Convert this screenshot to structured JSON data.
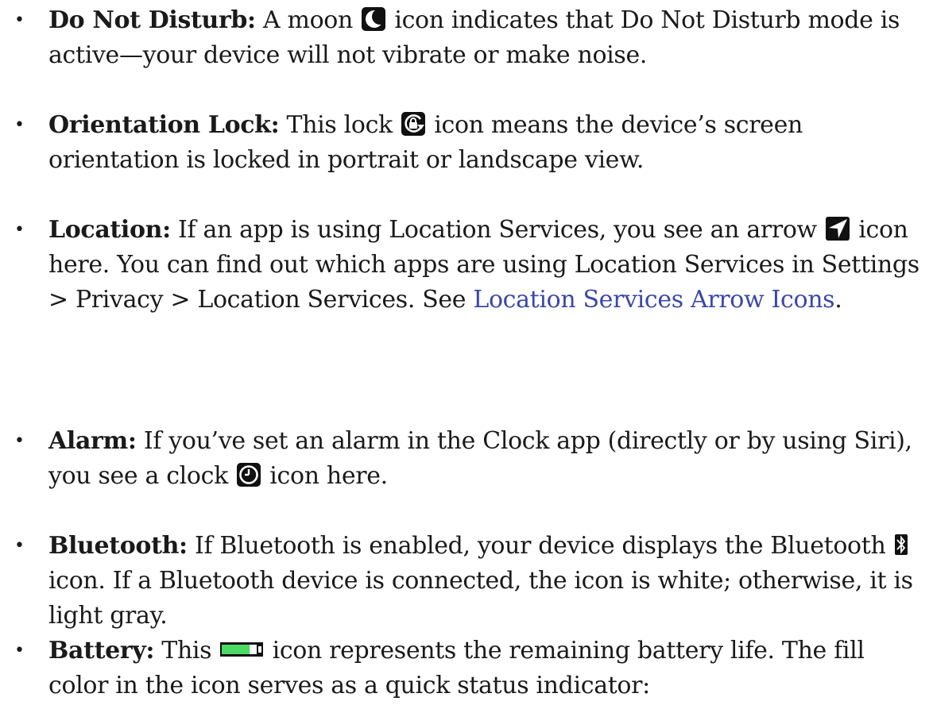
{
  "bullet_glyph": "•",
  "items": [
    {
      "term": "Do Not Disturb:",
      "text_before_icon": " A moon ",
      "text_after_icon": " icon indicates that Do Not Disturb mode is active—your device will not vibrate or make noise.",
      "icon": "moon-icon"
    },
    {
      "term": "Orientation Lock:",
      "text_before_icon": " This lock ",
      "text_after_icon": " icon means the device’s screen orientation is locked in portrait or landscape view.",
      "icon": "orientation-lock-icon"
    },
    {
      "term": "Location:",
      "text_before_icon": " If an app is using Location Services, you see an arrow ",
      "text_after_icon": " icon here. You can find out which apps are using Location Services in Settings > Privacy > Location Services. See ",
      "link_text": "Location Services Arrow Icons",
      "text_after_link": ".",
      "icon": "location-arrow-icon"
    },
    {
      "term": "Alarm:",
      "text_before_icon": " If you’ve set an alarm in the Clock app (directly or by using Siri), you see a clock ",
      "text_after_icon": " icon here.",
      "icon": "alarm-clock-icon"
    },
    {
      "term": "Bluetooth:",
      "text_before_icon": " If Bluetooth is enabled, your device displays the Bluetooth ",
      "text_after_icon": " icon. If a Bluetooth device is connected, the icon is white; otherwise, it is light gray.",
      "icon": "bluetooth-icon"
    },
    {
      "term": "Battery:",
      "text_before_icon": " This ",
      "text_after_icon": " icon represents the remaining battery life. The fill color in the icon serves as a quick status indicator:",
      "icon": "battery-icon",
      "battery_level": 0.8
    }
  ],
  "colors": {
    "text": "#1a1a1a",
    "link": "#3a48a8",
    "icon_background": "#111111",
    "battery_fill": "#4cd964"
  }
}
